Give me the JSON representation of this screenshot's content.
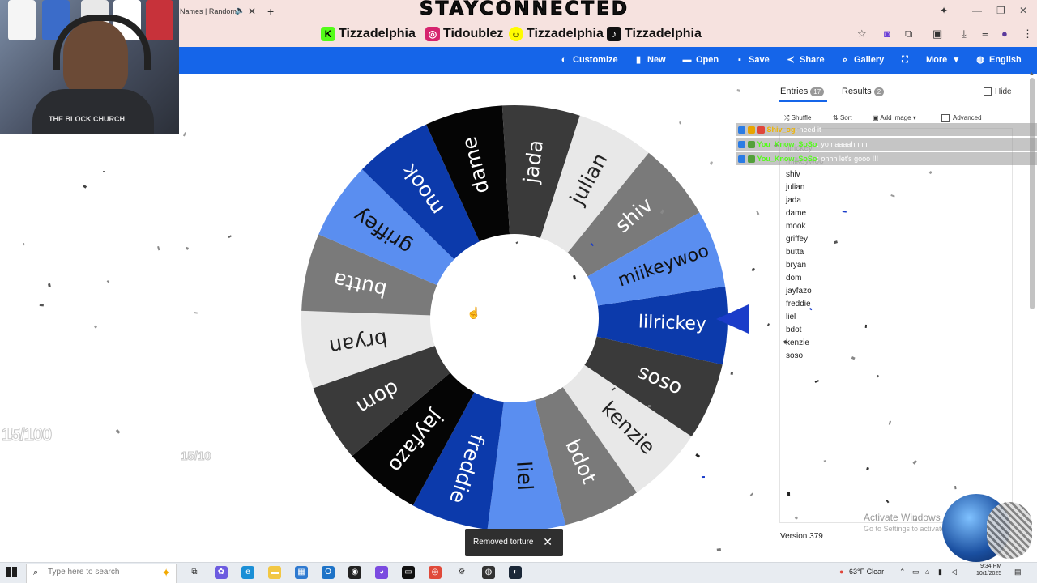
{
  "browser": {
    "tab_title": "Names | Random",
    "tab_close": "✕",
    "new_tab": "+",
    "window_controls": [
      "—",
      "❐",
      "✕"
    ]
  },
  "stream_overlay": {
    "brand": "STAYCONNECTED",
    "socials": [
      {
        "platform": "kick",
        "icon": "K",
        "handle": "Tizzadelphia",
        "color": "#53fc18"
      },
      {
        "platform": "instagram",
        "icon": "◎",
        "handle": "Tidoublez",
        "color": "#d6246e"
      },
      {
        "platform": "snapchat",
        "icon": "☺",
        "handle": "Tizzadelphia",
        "color": "#fffc00"
      },
      {
        "platform": "tiktok",
        "icon": "♪",
        "handle": "Tizzadelphia",
        "color": "#111111"
      }
    ],
    "counter_big": "15/100",
    "counter_small": "15/10",
    "webcam_shirt_text": "THE BLOCK CHURCH"
  },
  "toolbar": {
    "customize": "Customize",
    "new": "New",
    "open": "Open",
    "save": "Save",
    "share": "Share",
    "gallery": "Gallery",
    "more": "More",
    "language": "English"
  },
  "wheel": {
    "segments": [
      {
        "label": "lilrickey",
        "color": "#0c3aab",
        "text": "#ffffff"
      },
      {
        "label": "soso",
        "color": "#3a3a3a",
        "text": "#ffffff"
      },
      {
        "label": "kenzie",
        "color": "#e8e8e8",
        "text": "#222222"
      },
      {
        "label": "bdot",
        "color": "#7a7a7a",
        "text": "#ffffff"
      },
      {
        "label": "liel",
        "color": "#5a8ef0",
        "text": "#111111"
      },
      {
        "label": "freddie",
        "color": "#0c3aab",
        "text": "#ffffff"
      },
      {
        "label": "jayfazo",
        "color": "#050505",
        "text": "#ffffff"
      },
      {
        "label": "dom",
        "color": "#3a3a3a",
        "text": "#ffffff"
      },
      {
        "label": "bryan",
        "color": "#e8e8e8",
        "text": "#222222"
      },
      {
        "label": "butta",
        "color": "#7a7a7a",
        "text": "#ffffff"
      },
      {
        "label": "griffey",
        "color": "#5a8ef0",
        "text": "#111111"
      },
      {
        "label": "mook",
        "color": "#0c3aab",
        "text": "#ffffff"
      },
      {
        "label": "dame",
        "color": "#050505",
        "text": "#ffffff"
      },
      {
        "label": "jada",
        "color": "#3a3a3a",
        "text": "#ffffff"
      },
      {
        "label": "julian",
        "color": "#e8e8e8",
        "text": "#222222"
      },
      {
        "label": "shiv",
        "color": "#7a7a7a",
        "text": "#ffffff"
      },
      {
        "label": "miikeywoo",
        "color": "#5a8ef0",
        "text": "#111111"
      }
    ],
    "pointer_color": "#1b3cc9"
  },
  "panel": {
    "entries_tab": "Entries",
    "entries_count": "17",
    "results_tab": "Results",
    "results_count": "2",
    "hide": "Hide",
    "shuffle": "Shuffle",
    "sort": "Sort",
    "add_image": "Add image",
    "advanced": "Advanced",
    "entries": [
      "lilrickey",
      "miikeywoo",
      "shiv",
      "julian",
      "jada",
      "dame",
      "mook",
      "griffey",
      "butta",
      "bryan",
      "dom",
      "jayfazo",
      "freddie",
      "liel",
      "bdot",
      "kenzie",
      "soso"
    ],
    "version": "Version 379"
  },
  "chat": [
    {
      "user": "Shiv_og",
      "message": ": need it",
      "user_color": "#f0b400"
    },
    {
      "user": "You_Know_SoSo",
      "message": ": yo naaaahhhh",
      "user_color": "#53fc18"
    },
    {
      "user": "You_Know_SoSo",
      "message": ": ohhh let's gooo !!!",
      "user_color": "#53fc18"
    }
  ],
  "toast": {
    "message": "Removed torture",
    "close": "✕"
  },
  "watermark": {
    "line1": "Activate Windows",
    "line2": "Go to Settings to activate Windows."
  },
  "taskbar": {
    "search_placeholder": "Type here to search",
    "weather": "63°F  Clear",
    "time": "9:34 PM",
    "date": "10/1/2025"
  }
}
